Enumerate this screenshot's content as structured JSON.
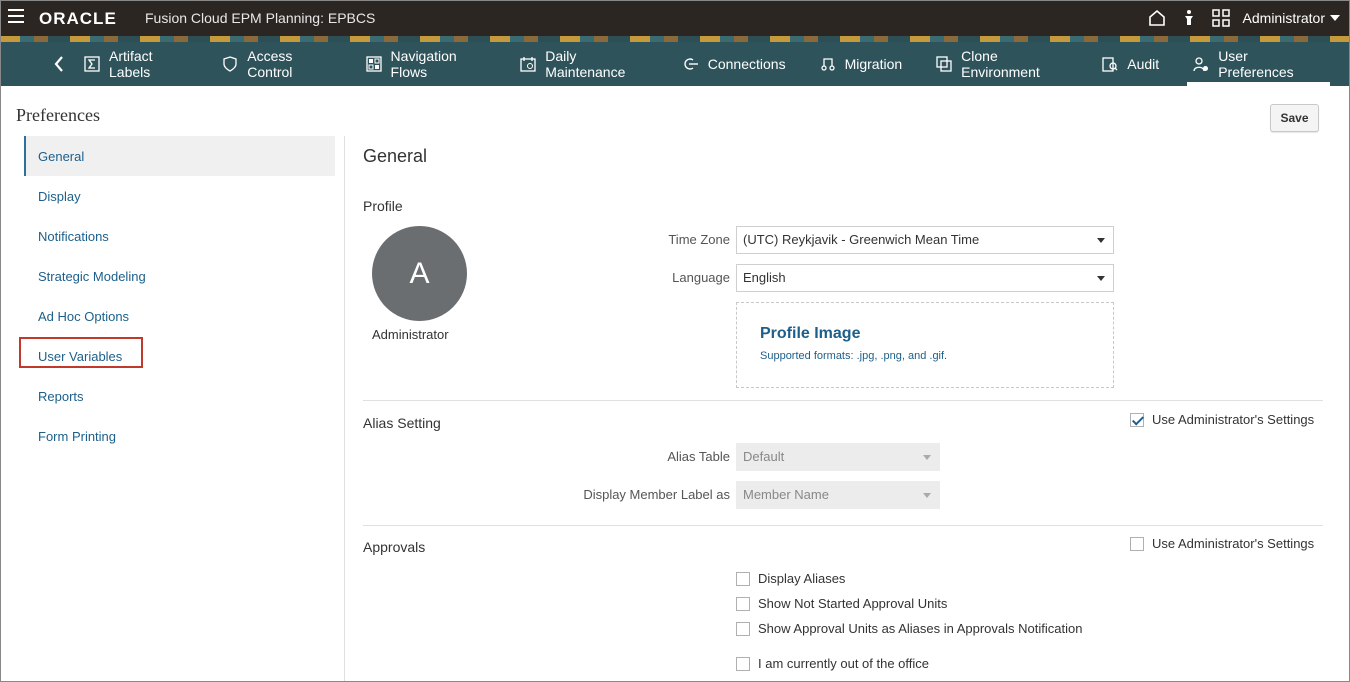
{
  "header": {
    "logo": "ORACLE",
    "app_title": "Fusion Cloud EPM Planning:  EPBCS",
    "user": "Administrator"
  },
  "nav": {
    "items": [
      {
        "label": "Artifact Labels",
        "icon": "sigma-icon"
      },
      {
        "label": "Access Control",
        "icon": "shield-icon"
      },
      {
        "label": "Navigation Flows",
        "icon": "flows-icon"
      },
      {
        "label": "Daily Maintenance",
        "icon": "calendar-icon"
      },
      {
        "label": "Connections",
        "icon": "connections-icon"
      },
      {
        "label": "Migration",
        "icon": "migration-icon"
      },
      {
        "label": "Clone Environment",
        "icon": "clone-icon"
      },
      {
        "label": "Audit",
        "icon": "audit-icon"
      },
      {
        "label": "User Preferences",
        "icon": "user-preferences-icon"
      }
    ],
    "active": "User Preferences"
  },
  "page": {
    "title": "Preferences",
    "save_label": "Save"
  },
  "sidebar": {
    "items": [
      {
        "label": "General"
      },
      {
        "label": "Display"
      },
      {
        "label": "Notifications"
      },
      {
        "label": "Strategic Modeling"
      },
      {
        "label": "Ad Hoc Options"
      },
      {
        "label": "User Variables"
      },
      {
        "label": "Reports"
      },
      {
        "label": "Form Printing"
      }
    ],
    "selected": "General",
    "highlighted": "User Variables"
  },
  "general": {
    "title": "General",
    "profile": {
      "heading": "Profile",
      "avatar_letter": "A",
      "avatar_name": "Administrator",
      "time_zone_label": "Time Zone",
      "time_zone_value": "(UTC) Reykjavik - Greenwich Mean Time",
      "language_label": "Language",
      "language_value": "English",
      "profile_image_title": "Profile Image",
      "profile_image_formats": "Supported formats: .jpg, .png, and .gif."
    },
    "alias": {
      "heading": "Alias Setting",
      "use_admin_label": "Use Administrator's Settings",
      "use_admin_checked": true,
      "alias_table_label": "Alias Table",
      "alias_table_value": "Default",
      "member_label_label": "Display Member Label as",
      "member_label_value": "Member Name"
    },
    "approvals": {
      "heading": "Approvals",
      "use_admin_label": "Use Administrator's Settings",
      "use_admin_checked": false,
      "options": [
        {
          "label": "Display Aliases",
          "checked": false
        },
        {
          "label": "Show Not Started Approval Units",
          "checked": false
        },
        {
          "label": "Show Approval Units as Aliases in Approvals Notification",
          "checked": false
        },
        {
          "label": "I am currently out of the office",
          "checked": false
        }
      ]
    }
  },
  "colors": {
    "header_bg": "#2b2622",
    "nav_bg": "#2f535b",
    "link": "#1d5f8a",
    "highlight": "#c0392b"
  }
}
